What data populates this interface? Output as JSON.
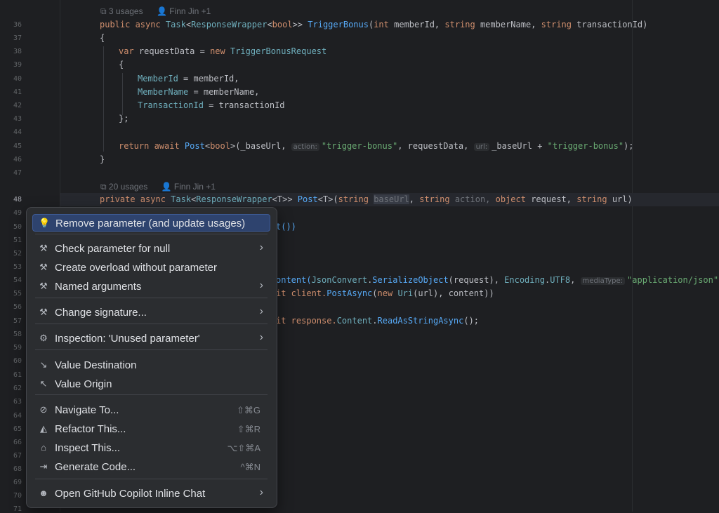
{
  "editor": {
    "line_numbers": [
      "36",
      "37",
      "38",
      "39",
      "40",
      "41",
      "42",
      "43",
      "44",
      "45",
      "46",
      "47",
      "48",
      "49",
      "50",
      "51",
      "52",
      "53",
      "54",
      "55",
      "56",
      "57",
      "58",
      "59",
      "60",
      "61",
      "62",
      "63",
      "64",
      "65",
      "66",
      "67",
      "68",
      "69",
      "70",
      "71"
    ],
    "lens1": {
      "usages": "3 usages",
      "author": "Finn Jin +1"
    },
    "lens2": {
      "usages": "20 usages",
      "author": "Finn Jin +1"
    },
    "code": {
      "l36": {
        "a": "public async ",
        "b": "Task",
        "c": "<",
        "d": "ResponseWrapper",
        "e": "<",
        "f": "bool",
        ">": ">> ",
        "g": "TriggerBonus",
        "h": "(",
        "i": "int",
        " j": " memberId, ",
        "k": "string",
        "l": " memberName, ",
        "m": "string",
        "n": " transactionId)"
      },
      "l37": "{",
      "l38": {
        "a": "var",
        " b": " requestData = ",
        "c": "new",
        " d": " ",
        "e": "TriggerBonusRequest"
      },
      "l39": "{",
      "l40": {
        "a": "MemberId",
        "b": " = memberId,"
      },
      "l41": {
        "a": "MemberName",
        "b": " = memberName,"
      },
      "l42": {
        "a": "TransactionId",
        "b": " = transactionId"
      },
      "l43": "};",
      "l45": {
        "a": "return await ",
        "b": "Post",
        "c": "<",
        "d": "bool",
        "e": ">(_baseUrl, ",
        "hint1": "action:",
        "f": "\"trigger-bonus\"",
        "g": ", requestData, ",
        "hint2": "url:",
        "h": "_baseUrl + ",
        "i": "\"trigger-bonus\"",
        "j": ");"
      },
      "l46": "}",
      "l48": {
        "a": "private async ",
        "b": "Task",
        "c": "<",
        "d": "ResponseWrapper",
        "e": "<T>> ",
        "f": "Post",
        "g": "<T>(",
        "h": "string",
        " i": " ",
        "j": "baseUrl",
        "k": ", ",
        "l": "string",
        "m": " action, ",
        "n": "object",
        "o": " request, ",
        "p": "string",
        "q": " url)"
      },
      "l50": "t())",
      "l54": {
        "a": "ontent(",
        "b": "JsonConvert",
        "c": ".",
        "d": "SerializeObject",
        "e": "(request), ",
        "f": "Encoding",
        "g": ".",
        "h": "UTF8",
        "i": ", ",
        "hint": "mediaType:",
        "j": "\"application/json\"",
        "k": ");"
      },
      "l55": {
        "a": "it client.",
        "b": "PostAsync",
        "c": "(",
        "d": "new",
        " e": " ",
        "f": "Uri",
        "g": "(url), content))"
      },
      "l57": {
        "a": "it response.",
        "b": "Content",
        "c": ".",
        "d": "ReadAsStringAsync",
        "e": "();"
      }
    }
  },
  "menu": {
    "items": [
      {
        "icon": "lightbulb-icon",
        "label": "Remove parameter (and update usages)",
        "shortcut": "",
        "submenu": false
      },
      {
        "icon": "hammer-icon",
        "label": "Check parameter for null",
        "shortcut": "",
        "submenu": true
      },
      {
        "icon": "hammer-icon",
        "label": "Create overload without parameter",
        "shortcut": "",
        "submenu": false
      },
      {
        "icon": "hammer-icon",
        "label": "Named arguments",
        "shortcut": "",
        "submenu": true
      },
      {
        "icon": "hammer-icon",
        "label": "Change signature...",
        "shortcut": "",
        "submenu": true
      },
      {
        "icon": "gear-icon",
        "label": "Inspection: 'Unused parameter'",
        "shortcut": "",
        "submenu": true
      },
      {
        "icon": "arrow-down-right-icon",
        "label": "Value Destination",
        "shortcut": "",
        "submenu": false
      },
      {
        "icon": "arrow-up-left-icon",
        "label": "Value Origin",
        "shortcut": "",
        "submenu": false
      },
      {
        "icon": "navigate-icon",
        "label": "Navigate To...",
        "shortcut": "⇧⌘G",
        "submenu": false
      },
      {
        "icon": "refactor-icon",
        "label": "Refactor This...",
        "shortcut": "⇧⌘R",
        "submenu": false
      },
      {
        "icon": "inspect-icon",
        "label": "Inspect This...",
        "shortcut": "⌥⇧⌘A",
        "submenu": false
      },
      {
        "icon": "generate-icon",
        "label": "Generate Code...",
        "shortcut": "^⌘N",
        "submenu": false
      },
      {
        "icon": "copilot-icon",
        "label": "Open GitHub Copilot Inline Chat",
        "shortcut": "",
        "submenu": true
      }
    ],
    "arrow_glyph": "›"
  },
  "colors": {
    "background": "#1e1f22",
    "menu_bg": "#2b2d30",
    "highlight": "#2e436e"
  }
}
